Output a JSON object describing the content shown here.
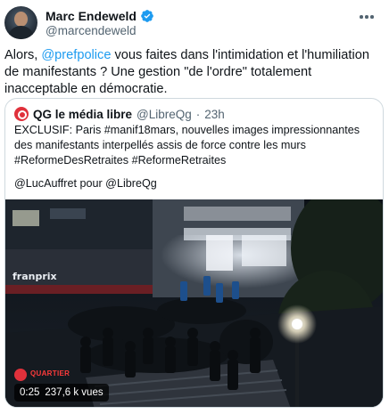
{
  "author": {
    "name": "Marc Endeweld",
    "handle": "@marcendeweld",
    "verified_icon": "verified-badge-icon",
    "verified_color": "#1d9bf0"
  },
  "tweet": {
    "text_before_mention": "Alors, ",
    "mention": "@prefpolice",
    "text_after_mention": " vous faites dans l'intimidation et l'humiliation de manifestants ? Une gestion \"de l'ordre\" totalement inacceptable en démocratie."
  },
  "quote": {
    "name": "QG le média libre",
    "handle": "@LibreQg",
    "separator": "·",
    "time": "23h",
    "text": "EXCLUSIF: Paris #manif18mars, nouvelles images impressionnantes des manifestants interpellés assis de force contre les murs #ReformeDesRetraites #ReformeRetraites",
    "credit": "@LucAuffret pour @LibreQg",
    "media": {
      "type": "video",
      "duration": "0:25",
      "views": "237,6 k vues",
      "watermark": "QUARTIER",
      "storefront_sign": "franprix"
    }
  },
  "colors": {
    "text": "#0f1419",
    "muted": "#536471",
    "link": "#1d9bf0",
    "border": "#cfd9de",
    "brand_red": "#e0313b"
  }
}
